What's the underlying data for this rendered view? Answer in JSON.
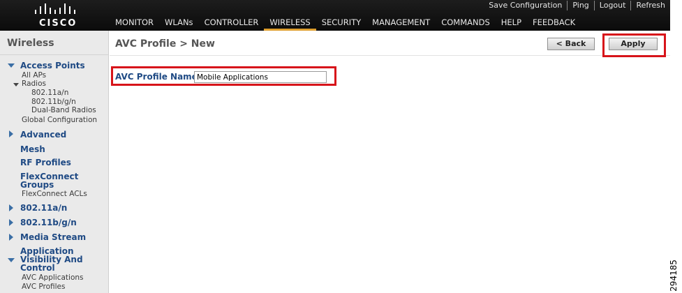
{
  "brand": {
    "logo_text": "CISCO"
  },
  "utility_nav": [
    {
      "label": "Save Configuration"
    },
    {
      "label": "Ping"
    },
    {
      "label": "Logout"
    },
    {
      "label": "Refresh"
    }
  ],
  "main_nav": [
    {
      "label": "MONITOR"
    },
    {
      "label": "WLANs"
    },
    {
      "label": "CONTROLLER"
    },
    {
      "label": "WIRELESS",
      "active": true
    },
    {
      "label": "SECURITY"
    },
    {
      "label": "MANAGEMENT"
    },
    {
      "label": "COMMANDS"
    },
    {
      "label": "HELP"
    },
    {
      "label": "FEEDBACK"
    }
  ],
  "sidebar": {
    "title": "Wireless",
    "access_points": {
      "label": "Access Points",
      "all_aps": "All APs",
      "radios": "Radios",
      "radio_items": [
        "802.11a/n",
        "802.11b/g/n",
        "Dual-Band Radios"
      ],
      "global_configuration": "Global Configuration"
    },
    "advanced": "Advanced",
    "mesh": "Mesh",
    "rf_profiles": "RF Profiles",
    "flexconnect_groups": "FlexConnect Groups",
    "flexconnect_acls": "FlexConnect ACLs",
    "band_a": "802.11a/n",
    "band_bg": "802.11b/g/n",
    "media_stream": "Media Stream",
    "avc": {
      "label": "Application Visibility And Control",
      "applications": "AVC Applications",
      "profiles": "AVC Profiles"
    }
  },
  "page": {
    "title": "AVC Profile > New",
    "back_label": "< Back",
    "apply_label": "Apply"
  },
  "form": {
    "profile_name_label": "AVC Profile Name",
    "profile_name_value": "Mobile Applications"
  },
  "figure_number": "294185",
  "colors": {
    "nav_background": "#111111",
    "active_tab_underline": "#e0a030",
    "sidebar_background": "#eaeaea",
    "link_blue": "#1f4a84",
    "highlight_red": "#d7141a"
  }
}
